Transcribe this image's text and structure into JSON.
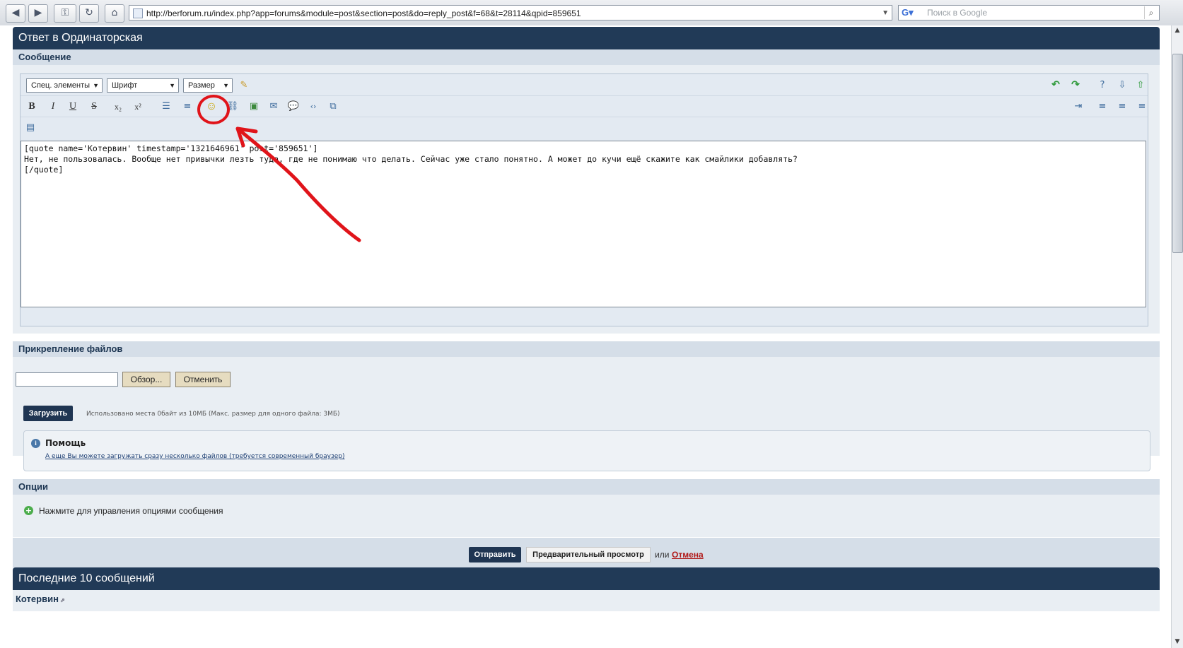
{
  "browser": {
    "url": "http://berforum.ru/index.php?app=forums&module=post&section=post&do=reply_post&f=68&t=28114&qpid=859651",
    "search_placeholder": "Поиск в Google"
  },
  "form": {
    "title": "Ответ в Ординаторская",
    "message_section": "Сообщение",
    "toolbar": {
      "special_select": "Спец. элементы",
      "font_select": "Шрифт",
      "size_select": "Размер",
      "bold": "B",
      "italic": "I",
      "underline": "U",
      "strike": "S",
      "subscript": "x₂",
      "superscript": "x²"
    },
    "editor_text": "[quote name='Котервин' timestamp='1321646961' post='859651']\nНет, не пользовалась. Вообще нет привычки лезть туда, где не понимаю что делать. Сейчас уже стало понятно. А может до кучи ещё скажите как смайлики добавлять?\n[/quote]"
  },
  "attachments": {
    "title": "Прикрепление файлов",
    "browse_button": "Обзор...",
    "cancel_button": "Отменить",
    "upload_button": "Загрузить",
    "usage_text": "Использовано места 0байт из 10МБ (Макс. размер для одного файла: 3МБ)",
    "help_title": "Помощь",
    "help_link": "А еще Вы можете загружать сразу несколько файлов (требуется современный браузер)"
  },
  "options": {
    "title": "Опции",
    "toggle_text": "Нажмите для управления опциями сообщения"
  },
  "actions": {
    "submit": "Отправить",
    "preview": "Предварительный просмотр",
    "or_text": "или",
    "cancel": "Отмена"
  },
  "recent": {
    "title": "Последние 10 сообщений",
    "author": "Котервин"
  },
  "colors": {
    "header": "#213a57",
    "annotation": "#e0141a"
  }
}
